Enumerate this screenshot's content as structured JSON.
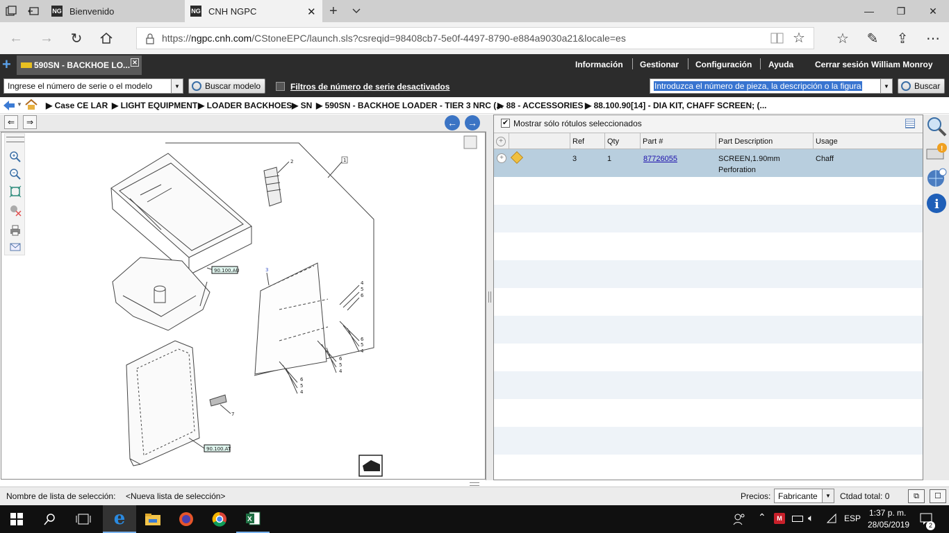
{
  "browser": {
    "tabs": [
      {
        "label": "Bienvenido",
        "favicon": "NG"
      },
      {
        "label": "CNH NGPC",
        "favicon": "NG",
        "active": true
      }
    ],
    "url_prefix": "https://",
    "url_host": "ngpc.cnh.com",
    "url_path": "/CStoneEPC/launch.sls?csreqid=98408cb7-5e0f-4497-8790-e884a9030a21&locale=es"
  },
  "app": {
    "tab_title": "590SN - BACKHOE LO...",
    "menu": {
      "info": "Información",
      "manage": "Gestionar",
      "config": "Configuración",
      "help": "Ayuda",
      "logout": "Cerrar sesión",
      "user": "William  Monroy"
    }
  },
  "toolbar": {
    "serial_placeholder": "Ingrese el número de serie o el modelo",
    "search_model_label": "Buscar modelo",
    "serial_filters_label": "Filtros de número de serie desactivados",
    "part_search_value": "Introduzca el número de pieza, la descripción o la figura",
    "search_label": "Buscar"
  },
  "breadcrumb": [
    "Case CE LAR",
    "LIGHT EQUIPMENT",
    "LOADER BACKHOES",
    "SN",
    "590SN - BACKHOE LOADER - TIER 3 NRC (...",
    "88 - ACCESSORIES",
    "88.100.90[14] - DIA KIT, CHAFF SCREEN; (..."
  ],
  "diagram": {
    "callouts": [
      "1",
      "2",
      "3",
      "4",
      "5",
      "6",
      "7"
    ],
    "ref_tag": "90.100.AU",
    "ref_tag_2": "90.100.AT"
  },
  "grid": {
    "show_selected_label": "Mostrar sólo rótulos seleccionados",
    "columns": [
      "Ref",
      "Qty",
      "Part #",
      "Part Description",
      "Usage"
    ],
    "rows": [
      {
        "ref": "3",
        "qty": "1",
        "part": "87726055",
        "description": "SCREEN,1.90mm Perforation",
        "usage": "Chaff"
      }
    ]
  },
  "status": {
    "selection_list_label": "Nombre de lista de selección:",
    "selection_list_value": "<Nueva lista de selección>",
    "prices_label": "Precios:",
    "prices_value": "Fabricante",
    "total_label": "Ctdad total: 0"
  },
  "taskbar": {
    "lang": "ESP",
    "time": "1:37 p. m.",
    "date": "28/05/2019",
    "notifications": "2"
  },
  "colors": {
    "accent": "#2c2c2c",
    "selected_row": "#b8cede",
    "link": "#1a0dab"
  }
}
